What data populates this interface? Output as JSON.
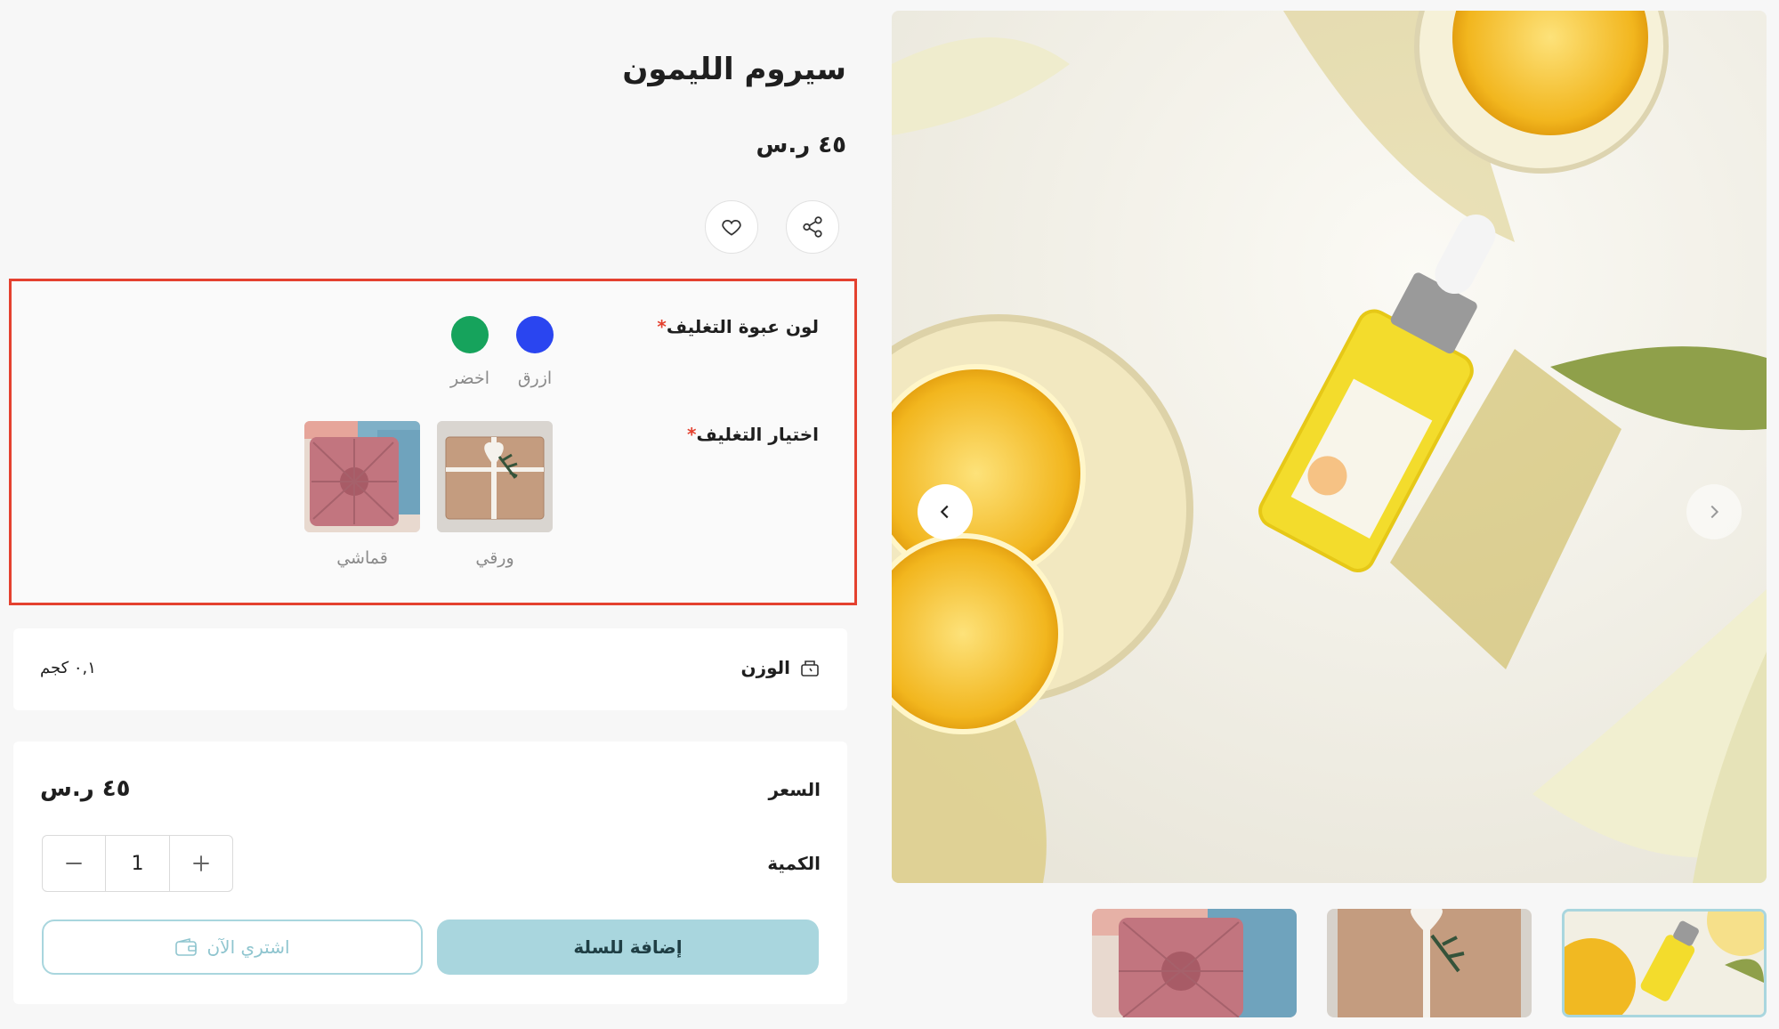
{
  "product": {
    "title": "سيروم الليمون",
    "price": "٤٥ ر.س"
  },
  "options": {
    "color": {
      "label": "لون عبوة التغليف",
      "required_mark": "*",
      "choices": [
        {
          "label": "ازرق",
          "color": "#2a45f0"
        },
        {
          "label": "اخضر",
          "color": "#16a35c"
        }
      ]
    },
    "wrapping": {
      "label": "اختيار التغليف",
      "required_mark": "*",
      "choices": [
        {
          "label": "ورقي"
        },
        {
          "label": "قماشي"
        }
      ]
    }
  },
  "weight": {
    "label": "الوزن",
    "value": "٠,١ كجم"
  },
  "purchase": {
    "price_label": "السعر",
    "price_value": "٤٥ ر.س",
    "quantity_label": "الكمية",
    "quantity_value": "1",
    "add_to_cart": "إضافة للسلة",
    "buy_now": "اشتري الآن"
  },
  "colors": {
    "accent": "#a9d6de",
    "required": "#e4412f",
    "highlight_border": "#e4412f"
  },
  "icons": {
    "share": "share-icon",
    "wishlist": "heart-icon",
    "weight": "scale-icon",
    "buy_now": "wallet-icon",
    "prev": "chevron-left-icon",
    "next": "chevron-right-icon"
  }
}
